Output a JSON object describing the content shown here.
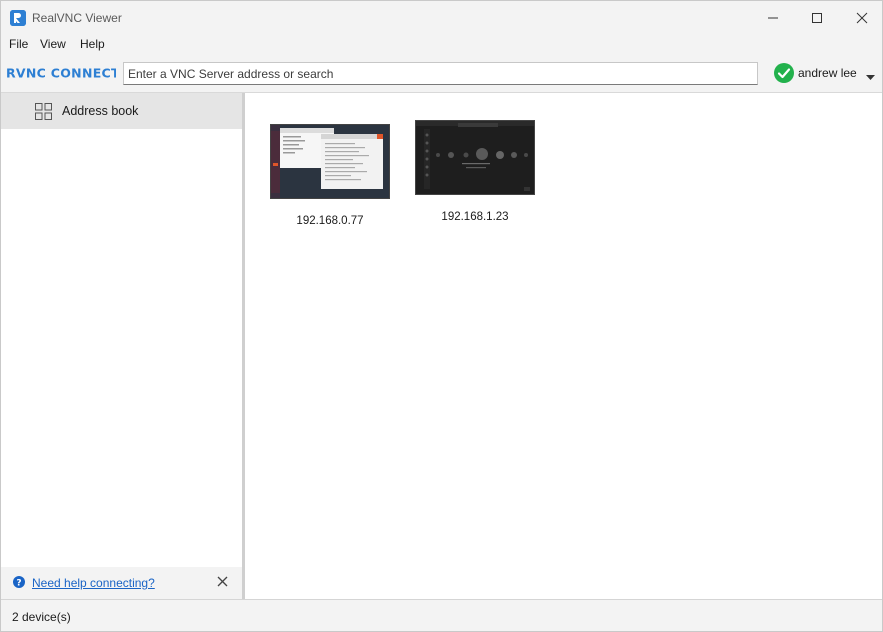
{
  "window": {
    "title": "RealVNC Viewer",
    "icon": "realvnc-app-icon"
  },
  "menu": {
    "items": [
      "File",
      "View",
      "Help"
    ]
  },
  "toolbar": {
    "brand": "RVNC CONNECT",
    "search_placeholder": "Enter a VNC Server address or search",
    "user_name": "andrew lee",
    "signed_in_color": "#22b14c"
  },
  "sidebar": {
    "items": [
      {
        "label": "Address book",
        "icon": "grid-icon",
        "selected": true
      }
    ],
    "help": {
      "link": "Need help connecting?"
    }
  },
  "devices": [
    {
      "label": "192.168.0.77",
      "theme": "ubuntu-light-windows"
    },
    {
      "label": "192.168.1.23",
      "theme": "dark-desktop"
    }
  ],
  "status": {
    "text": "2 device(s)"
  },
  "colors": {
    "accent": "#1a64c6",
    "brand": "#2d7fd3",
    "chrome": "#f3f3f3",
    "selected": "#e5e5e5"
  }
}
